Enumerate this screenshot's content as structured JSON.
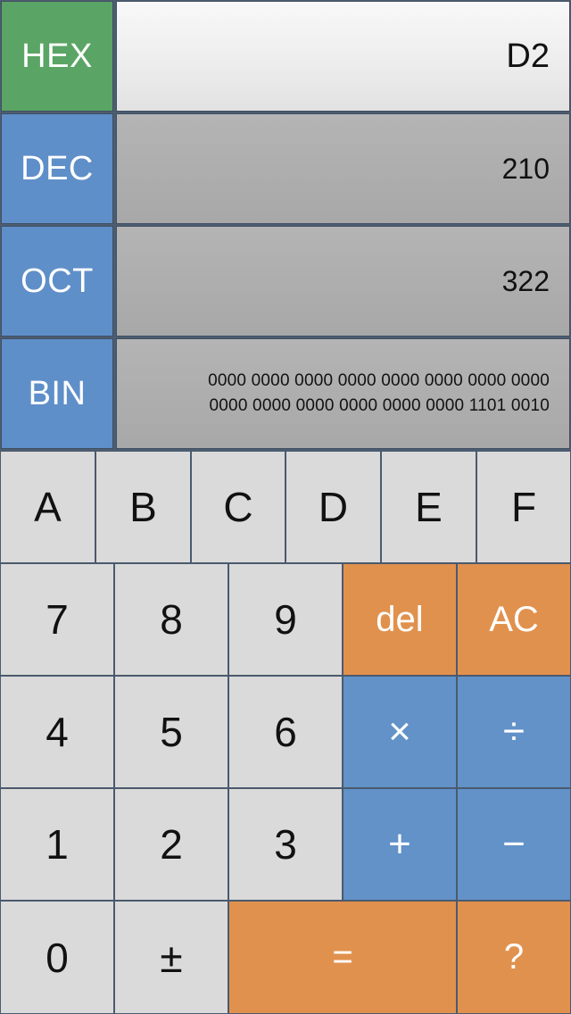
{
  "display": {
    "hex": {
      "label": "HEX",
      "value": "D2"
    },
    "dec": {
      "label": "DEC",
      "value": "210"
    },
    "oct": {
      "label": "OCT",
      "value": "322"
    },
    "bin": {
      "label": "BIN",
      "line1": "0000 0000 0000 0000 0000 0000 0000 0000",
      "line2": "0000 0000 0000 0000 0000 0000 1101 0010"
    }
  },
  "keypad": {
    "hex_row": [
      "A",
      "B",
      "C",
      "D",
      "E",
      "F"
    ],
    "row1": [
      "7",
      "8",
      "9",
      "del",
      "AC"
    ],
    "row2": [
      "4",
      "5",
      "6",
      "×",
      "÷"
    ],
    "row3": [
      "1",
      "2",
      "3",
      "+",
      "−"
    ],
    "row4": [
      "0",
      "±",
      "=",
      "?"
    ]
  },
  "colors": {
    "active_mode": "#5aa565",
    "inactive_mode": "#5f8fc9",
    "operator_orange": "#e1914e",
    "operator_blue": "#6292c8",
    "key_gray": "#dadada"
  }
}
